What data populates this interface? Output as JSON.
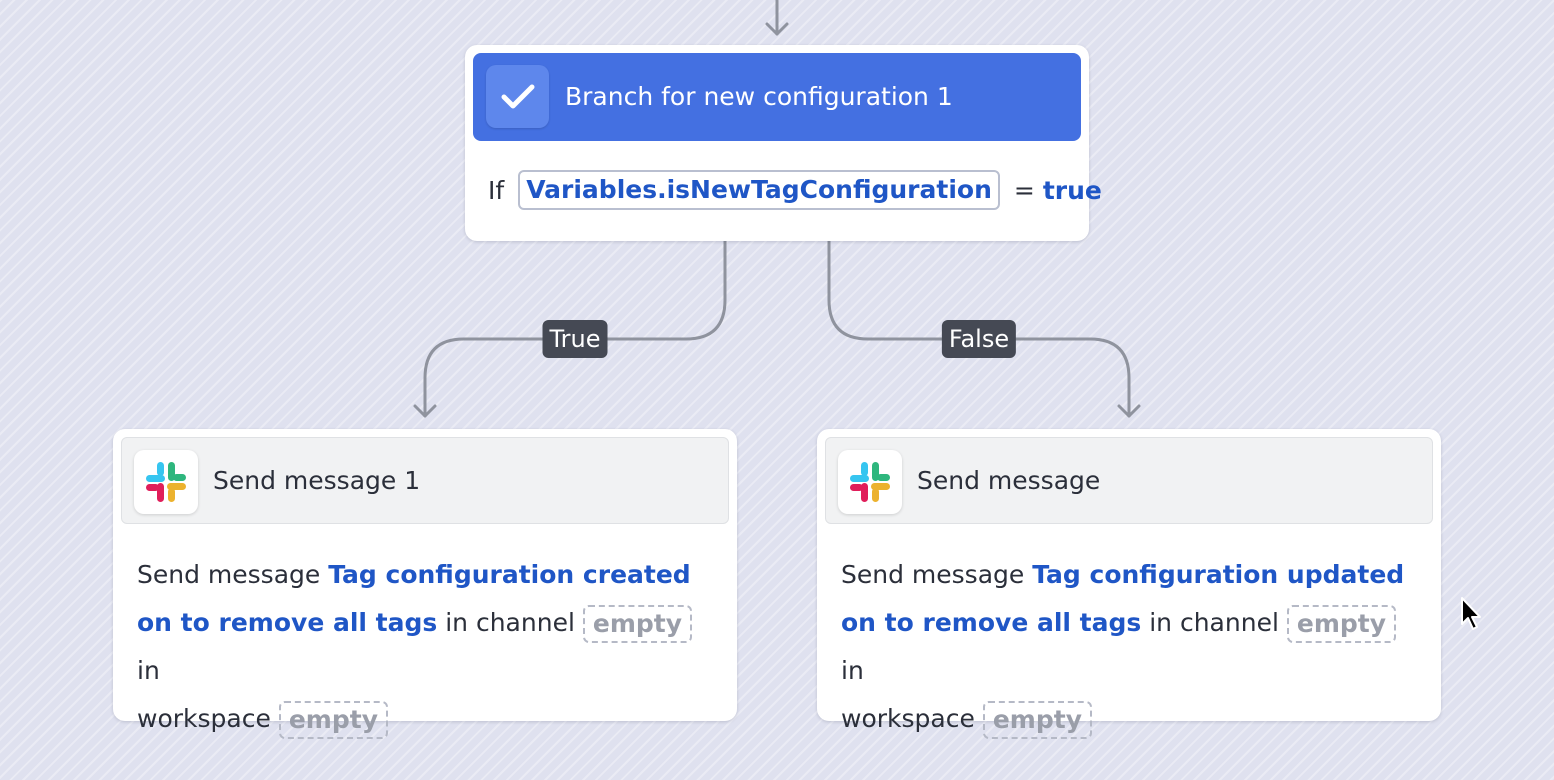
{
  "branch": {
    "title": "Branch for new configuration 1",
    "icon": "checkmark-icon",
    "condition": {
      "keyword": "If",
      "variable": "Variables.isNewTagConfiguration",
      "operator": "=",
      "value": "true"
    }
  },
  "edges": {
    "true_label": "True",
    "false_label": "False"
  },
  "cards": [
    {
      "title": "Send message 1",
      "icon": "slack-icon",
      "prefix": "Send message",
      "message": "Tag configuration created on to remove all tags",
      "channel_text": "in channel",
      "channel_value": "empty",
      "in_text": "in",
      "workspace_text": "workspace",
      "workspace_value": "empty"
    },
    {
      "title": "Send message",
      "icon": "slack-icon",
      "prefix": "Send message",
      "message": "Tag configuration updated on to remove all tags",
      "channel_text": "in channel",
      "channel_value": "empty",
      "in_text": "in",
      "workspace_text": "workspace",
      "workspace_value": "empty"
    }
  ],
  "colors": {
    "accent": "#4470e1",
    "link": "#1f56c6",
    "canvas": "#dfe1ef",
    "edge_label_bg": "#454954"
  }
}
